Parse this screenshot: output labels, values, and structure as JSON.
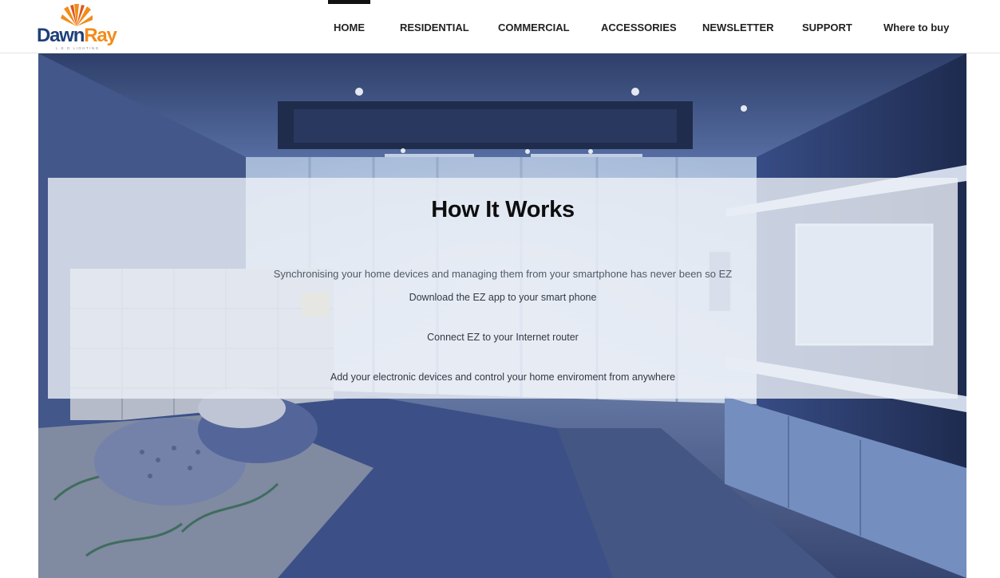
{
  "brand": {
    "name_part1": "Dawn",
    "name_part2": "Ray",
    "tagline": "L.E.D LIGHTING",
    "colors": {
      "navy": "#1f3f7a",
      "orange": "#f28c1a"
    }
  },
  "nav": {
    "items": [
      {
        "label": "HOME",
        "active": true
      },
      {
        "label": "RESIDENTIAL"
      },
      {
        "label": "COMMERCIAL"
      },
      {
        "label": "ACCESSORIES"
      },
      {
        "label": "NEWSLETTER"
      },
      {
        "label": "SUPPORT"
      },
      {
        "label": "Where to buy"
      }
    ]
  },
  "hero": {
    "title": "How It Works",
    "subtitle": "Synchronising your home devices and managing them from your smartphone has never been so EZ",
    "steps": [
      "Download the EZ app to your smart phone",
      "Connect EZ to your Internet router",
      "Add your electronic devices and control your home enviroment from anywhere"
    ]
  }
}
